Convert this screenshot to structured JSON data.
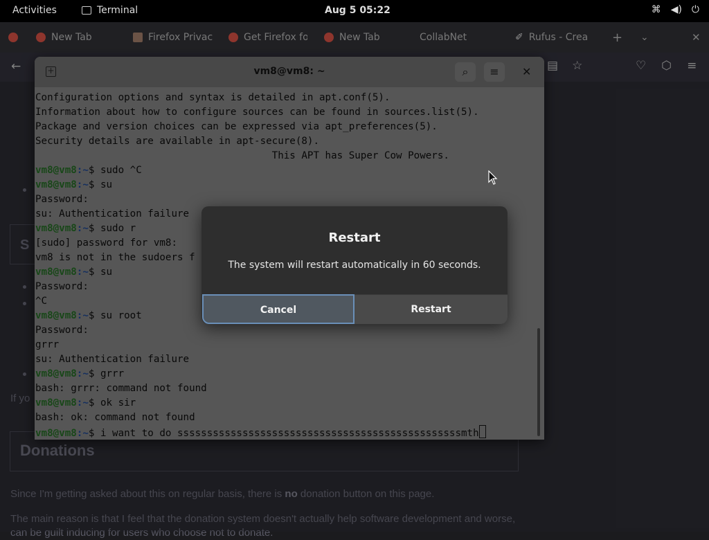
{
  "topbar": {
    "activities": "Activities",
    "app": "Terminal",
    "clock": "Aug 5  05:22",
    "icons": [
      "network-icon",
      "volume-icon",
      "power-icon"
    ]
  },
  "browser": {
    "tabs": [
      {
        "label": "New Tab",
        "icon": "firefox-icon"
      },
      {
        "label": "Firefox Privac",
        "icon": "m-icon"
      },
      {
        "label": "Get Firefox fo",
        "icon": "firefox-icon"
      },
      {
        "label": "New Tab",
        "icon": "firefox-icon"
      },
      {
        "label": "CollabNet",
        "icon": ""
      },
      {
        "label": "Rufus - Crea",
        "icon": "rufus-icon"
      }
    ]
  },
  "page": {
    "donations_heading": "Donations",
    "if_you": "If yo",
    "stub_heading": "S",
    "para1_pre": "Since I'm getting asked about this on regular basis, there is ",
    "para1_bold": "no",
    "para1_post": " donation button on this page.",
    "para2": "The main reason is that I feel that the donation system doesn't actually help software development and worse, can be guilt inducing for users who choose not to donate."
  },
  "terminal": {
    "title": "vm8@vm8: ~",
    "prompt_user": "vm8@vm8",
    "prompt_path": ":~",
    "lines": [
      {
        "text": "Configuration options and syntax is detailed in apt.conf(5)."
      },
      {
        "text": "Information about how to configure sources can be found in sources.list(5)."
      },
      {
        "text": "Package and version choices can be expressed via apt_preferences(5)."
      },
      {
        "text": "Security details are available in apt-secure(8)."
      },
      {
        "text": "                                        This APT has Super Cow Powers."
      },
      {
        "prompt": true,
        "text": "$ sudo ^C"
      },
      {
        "prompt": true,
        "text": "$ su"
      },
      {
        "text": "Password:"
      },
      {
        "text": "su: Authentication failure"
      },
      {
        "prompt": true,
        "text": "$ sudo r"
      },
      {
        "text": "[sudo] password for vm8:"
      },
      {
        "text": "vm8 is not in the sudoers f"
      },
      {
        "prompt": true,
        "text": "$ su"
      },
      {
        "text": "Password:"
      },
      {
        "text": "^C"
      },
      {
        "prompt": true,
        "text": "$ su root"
      },
      {
        "text": "Password:"
      },
      {
        "text": "grrr"
      },
      {
        "text": "su: Authentication failure"
      },
      {
        "prompt": true,
        "text": "$ grrr"
      },
      {
        "text": "bash: grrr: command not found"
      },
      {
        "prompt": true,
        "text": "$ ok sir"
      },
      {
        "text": "bash: ok: command not found"
      },
      {
        "prompt": true,
        "cursor": true,
        "text": "$ i want to do ssssssssssssssssssssssssssssssssssssssssssssssssmth"
      }
    ]
  },
  "dialog": {
    "title": "Restart",
    "message": "The system will restart automatically in 60 seconds.",
    "cancel": "Cancel",
    "restart": "Restart"
  }
}
